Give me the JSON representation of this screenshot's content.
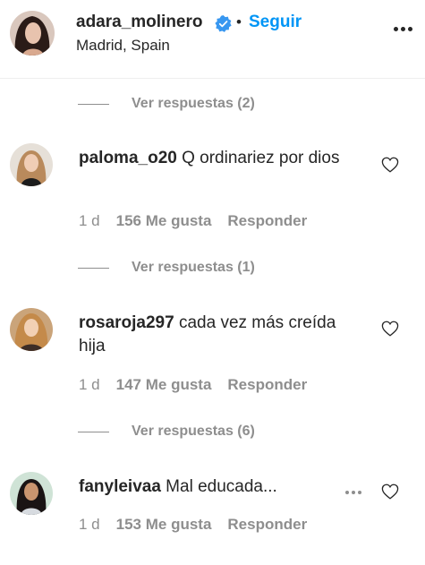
{
  "header": {
    "username": "adara_molinero",
    "separator": "•",
    "follow_label": "Seguir",
    "location": "Madrid, Spain",
    "verified_icon": "verified-badge-icon",
    "more_icon": "more-options-icon"
  },
  "colors": {
    "accent": "#0095f6",
    "text": "#262626",
    "muted": "#8e8e8e",
    "divider": "#efefef"
  },
  "replies": [
    {
      "label": "Ver respuestas (2)"
    },
    {
      "label": "Ver respuestas (1)"
    },
    {
      "label": "Ver respuestas (6)"
    }
  ],
  "comments": [
    {
      "username": "paloma_o20",
      "text": " Q ordinariez por dios",
      "time": "1 d",
      "likes": "156 Me gusta",
      "reply_label": "Responder"
    },
    {
      "username": "rosaroja297",
      "text": " cada vez más creída hija",
      "time": "1 d",
      "likes": "147 Me gusta",
      "reply_label": "Responder"
    },
    {
      "username": "fanyleivaa",
      "text": " Mal educada...",
      "time": "1 d",
      "likes": "153 Me gusta",
      "reply_label": "Responder"
    }
  ]
}
